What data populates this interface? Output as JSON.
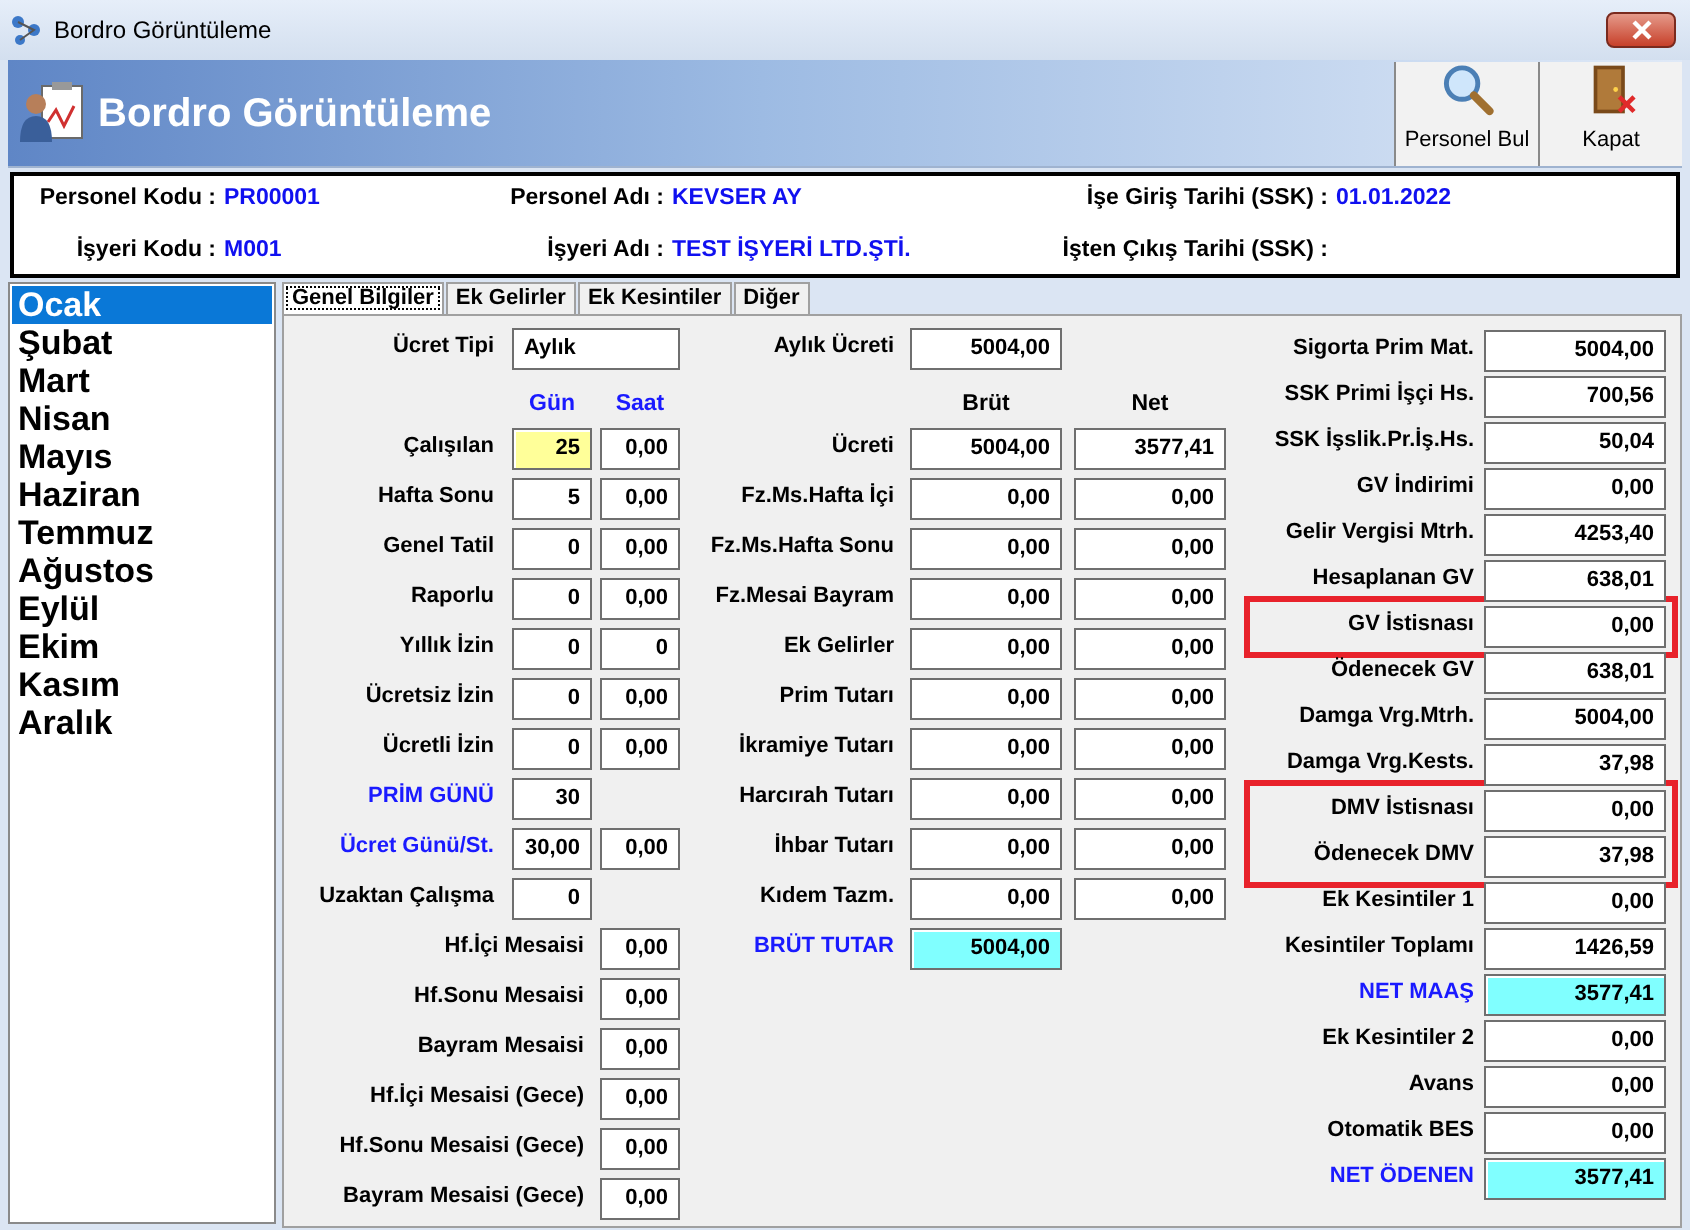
{
  "window": {
    "title": "Bordro Görüntüleme"
  },
  "banner": {
    "title": "Bordro Görüntüleme",
    "buttons": [
      {
        "kind": "search",
        "label": "Personel Bul"
      },
      {
        "kind": "close",
        "label": "Kapat"
      }
    ]
  },
  "employee": [
    {
      "label": "Personel Kodu :",
      "value": "PR00001"
    },
    {
      "label": "Personel Adı :",
      "value": "KEVSER AY"
    },
    {
      "label": "İşe Giriş Tarihi (SSK) :",
      "value": "01.01.2022"
    },
    {
      "label": "İşyeri Kodu :",
      "value": "M001"
    },
    {
      "label": "İşyeri Adı :",
      "value": "TEST İŞYERİ LTD.ŞTİ."
    },
    {
      "label": "İşten Çıkış Tarihi (SSK) :"
    }
  ],
  "months": [
    {
      "label": "Ocak",
      "selected": true
    },
    {
      "label": "Şubat",
      "selected": false
    },
    {
      "label": "Mart",
      "selected": false
    },
    {
      "label": "Nisan",
      "selected": false
    },
    {
      "label": "Mayıs",
      "selected": false
    },
    {
      "label": "Haziran",
      "selected": false
    },
    {
      "label": "Temmuz",
      "selected": false
    },
    {
      "label": "Ağustos",
      "selected": false
    },
    {
      "label": "Eylül",
      "selected": false
    },
    {
      "label": "Ekim",
      "selected": false
    },
    {
      "label": "Kasım",
      "selected": false
    },
    {
      "label": "Aralık",
      "selected": false
    }
  ],
  "tabs": [
    {
      "label": "Genel Bilgiler",
      "selected": true
    },
    {
      "label": "Ek Gelirler",
      "selected": false
    },
    {
      "label": "Ek Kesintiler",
      "selected": false
    },
    {
      "label": "Diğer",
      "selected": false
    }
  ],
  "days": {
    "first": {
      "label": "Ücret Tipi",
      "value": "Aylık"
    },
    "headers": [
      "Gün",
      "Saat"
    ],
    "rows": [
      {
        "kind": "pair",
        "label": "Çalışılan",
        "day": "25",
        "hour": "0,00",
        "focused": true,
        "emphasis": false
      },
      {
        "kind": "pair",
        "label": "Hafta Sonu",
        "day": "5",
        "hour": "0,00",
        "focused": false,
        "emphasis": false
      },
      {
        "kind": "pair",
        "label": "Genel Tatil",
        "day": "0",
        "hour": "0,00",
        "focused": false,
        "emphasis": false
      },
      {
        "kind": "pair",
        "label": "Raporlu",
        "day": "0",
        "hour": "0,00",
        "focused": false,
        "emphasis": false
      },
      {
        "kind": "pair",
        "label": "Yıllık İzin",
        "day": "0",
        "hour": "0",
        "focused": false,
        "emphasis": false
      },
      {
        "kind": "pair",
        "label": "Ücretsiz İzin",
        "day": "0",
        "hour": "0,00",
        "focused": false,
        "emphasis": false
      },
      {
        "kind": "pair",
        "label": "Ücretli İzin",
        "day": "0",
        "hour": "0,00",
        "focused": false,
        "emphasis": false
      },
      {
        "kind": "day",
        "label": "PRİM GÜNÜ",
        "day": "30",
        "focused": false,
        "emphasis": true
      },
      {
        "kind": "pair",
        "label": "Ücret Günü/St.",
        "day": "30,00",
        "hour": "0,00",
        "focused": false,
        "emphasis": true
      },
      {
        "kind": "day",
        "label": "Uzaktan Çalışma",
        "day": "0",
        "focused": false,
        "emphasis": false
      },
      {
        "kind": "overtime",
        "label": "Hf.İçi Mesaisi",
        "hour": "0,00",
        "focused": false,
        "emphasis": false
      },
      {
        "kind": "overtime",
        "label": "Hf.Sonu Mesaisi",
        "hour": "0,00",
        "focused": false,
        "emphasis": false
      },
      {
        "kind": "overtime",
        "label": "Bayram Mesaisi",
        "hour": "0,00",
        "focused": false,
        "emphasis": false
      },
      {
        "kind": "overtime",
        "label": "Hf.İçi Mesaisi (Gece)",
        "hour": "0,00",
        "focused": false,
        "emphasis": false
      },
      {
        "kind": "overtime",
        "label": "Hf.Sonu Mesaisi (Gece)",
        "hour": "0,00",
        "focused": false,
        "emphasis": false
      },
      {
        "kind": "overtime",
        "label": "Bayram Mesaisi (Gece)",
        "hour": "0,00",
        "focused": false,
        "emphasis": false
      }
    ]
  },
  "earnings": {
    "first": {
      "label": "Aylık Ücreti",
      "value": "5004,00"
    },
    "headers": [
      "Brüt",
      "Net"
    ],
    "rows": [
      {
        "kind": "pair",
        "label": "Ücreti",
        "gross": "5004,00",
        "net": "3577,41"
      },
      {
        "kind": "pair",
        "label": "Fz.Ms.Hafta İçi",
        "gross": "0,00",
        "net": "0,00"
      },
      {
        "kind": "pair",
        "label": "Fz.Ms.Hafta Sonu",
        "gross": "0,00",
        "net": "0,00"
      },
      {
        "kind": "pair",
        "label": "Fz.Mesai Bayram",
        "gross": "0,00",
        "net": "0,00"
      },
      {
        "kind": "pair",
        "label": "Ek Gelirler",
        "gross": "0,00",
        "net": "0,00"
      },
      {
        "kind": "pair",
        "label": "Prim Tutarı",
        "gross": "0,00",
        "net": "0,00"
      },
      {
        "kind": "pair",
        "label": "İkramiye Tutarı",
        "gross": "0,00",
        "net": "0,00"
      },
      {
        "kind": "pair",
        "label": "Harcırah Tutarı",
        "gross": "0,00",
        "net": "0,00"
      },
      {
        "kind": "pair",
        "label": "İhbar Tutarı",
        "gross": "0,00",
        "net": "0,00"
      },
      {
        "kind": "pair",
        "label": "Kıdem Tazm.",
        "gross": "0,00",
        "net": "0,00"
      },
      {
        "kind": "total",
        "label": "BRÜT TUTAR",
        "gross": "5004,00"
      }
    ]
  },
  "deductions": [
    {
      "kind": "plain",
      "label": "Sigorta Prim Mat.",
      "value": "5004,00",
      "highlighted": false
    },
    {
      "kind": "plain",
      "label": "SSK Primi İşçi Hs.",
      "value": "700,56",
      "highlighted": false
    },
    {
      "kind": "plain",
      "label": "SSK İşslik.Pr.İş.Hs.",
      "value": "50,04",
      "highlighted": false
    },
    {
      "kind": "plain",
      "label": "GV İndirimi",
      "value": "0,00",
      "highlighted": false
    },
    {
      "kind": "plain",
      "label": "Gelir Vergisi Mtrh.",
      "value": "4253,40",
      "highlighted": false
    },
    {
      "kind": "plain",
      "label": "Hesaplanan GV",
      "value": "638,01",
      "highlighted": false
    },
    {
      "kind": "plain",
      "label": "GV İstisnası",
      "value": "0,00",
      "highlighted": true
    },
    {
      "kind": "plain",
      "label": "Ödenecek GV",
      "value": "638,01",
      "highlighted": false
    },
    {
      "kind": "plain",
      "label": "Damga Vrg.Mtrh.",
      "value": "5004,00",
      "highlighted": false
    },
    {
      "kind": "plain",
      "label": "Damga Vrg.Kests.",
      "value": "37,98",
      "highlighted": false
    },
    {
      "kind": "plain",
      "label": "DMV İstisnası",
      "value": "0,00",
      "highlighted": true
    },
    {
      "kind": "plain",
      "label": "Ödenecek DMV",
      "value": "37,98",
      "highlighted": true
    },
    {
      "kind": "plain",
      "label": "Ek Kesintiler 1",
      "value": "0,00",
      "highlighted": false
    },
    {
      "kind": "plain",
      "label": "Kesintiler Toplamı",
      "value": "1426,59",
      "highlighted": false
    },
    {
      "kind": "total",
      "label": "NET MAAŞ",
      "value": "3577,41",
      "highlighted": false
    },
    {
      "kind": "plain",
      "label": "Ek Kesintiler 2",
      "value": "0,00",
      "highlighted": false
    },
    {
      "kind": "plain",
      "label": "Avans",
      "value": "0,00",
      "highlighted": false
    },
    {
      "kind": "plain",
      "label": "Otomatik BES",
      "value": "0,00",
      "highlighted": false
    },
    {
      "kind": "total",
      "label": "NET ÖDENEN",
      "value": "3577,41",
      "highlighted": false
    }
  ]
}
